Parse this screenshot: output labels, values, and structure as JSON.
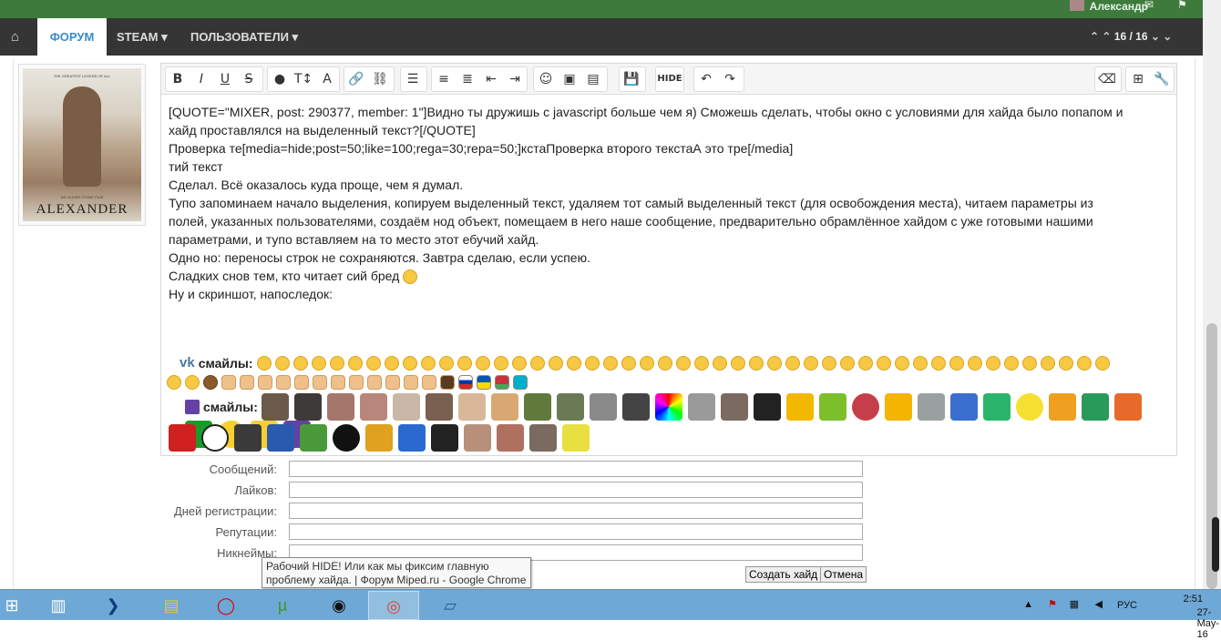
{
  "topbar": {
    "username": "Александр",
    "envelope_icon": "envelope-icon",
    "flag_icon": "flag-icon"
  },
  "nav": {
    "home_icon": "home-icon",
    "forum": "ФОРУМ",
    "steam": "STEAM",
    "users": "ПОЛЬЗОВАТЕЛИ",
    "pager": "16 / 16"
  },
  "avatar": {
    "poster_title": "ALEXANDER",
    "poster_tagline": "THE GREATEST LEGEND OF ALL",
    "poster_credit": "AN OLIVER STONE FILM"
  },
  "editor": {
    "hide_label": "HIDE",
    "lines": [
      "[QUOTE=\"MIXER, post: 290377, member: 1\"]Видно ты дружишь с javascript больше чем я) Сможешь сделать, чтобы окно с условиями для хайда было попапом и",
      "хайд проставлялся на выделенный текст?[/QUOTE]",
      "Проверка те[media=hide;post=50;like=100;rega=30;repa=50;]кстаПроверка второго текстаА это тре[/media]",
      "тий текст",
      "Сделал. Всё оказалось куда проще, чем я думал.",
      "Тупо запоминаем начало выделения, копируем выделенный текст, удаляем тот самый выделенный текст (для освобождения места), читаем параметры из",
      "полей, указанных пользователями, создаём нод объект, помещаем в него наше сообщение, предварительно обрамлённое хайдом с уже готовыми нашими",
      "параметрами, и тупо вставляем на то место этот ебучий хайд.",
      "Одно но: переносы строк не сохраняются. Завтра сделаю, если успею.",
      "Сладких снов тем, кто читает сий бред",
      "Ну и скриншот, напоследок:"
    ],
    "vk_label": "смайлы:",
    "twitch_label": "смайлы:",
    "vk_logo": "vk"
  },
  "form": {
    "posts_label": "Сообщений:",
    "likes_label": "Лайков:",
    "days_label": "Дней регистрации:",
    "rep_label": "Репутации:",
    "nick_label": "Никнеймы:",
    "create_button": "Создать хайд",
    "cancel_button": "Отмена"
  },
  "tooltip": {
    "line1": "Рабочий HIDE! Или как мы фиксим главную",
    "line2": "проблему хайда. | Форум Miped.ru - Google Chrome"
  },
  "taskbar": {
    "lang": "РУС",
    "time": "2:51",
    "date": "27-May-16"
  },
  "colors": {
    "topbar": "#3d7a3c",
    "navbar": "#353535",
    "accent": "#3a8bc9",
    "taskbar": "#6ea8d6"
  }
}
